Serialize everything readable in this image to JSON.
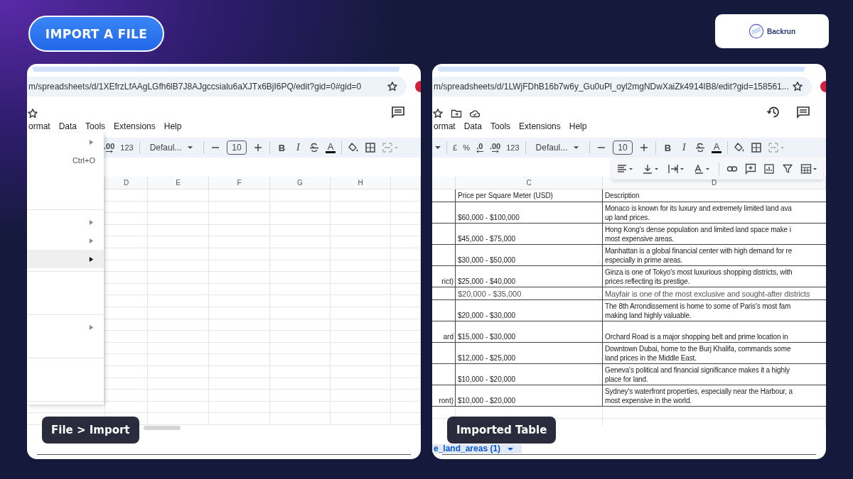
{
  "header": {
    "button": "IMPORT A FILE",
    "logo": "Backrun"
  },
  "panels": [
    {
      "kind": "menu-open",
      "url": "m/spreadsheets/d/1XEfrzLfAAgLGfh6lB7J8AJgccsialu6aXJTx6BjI6PQ/edit?gid=0#gid=0",
      "top_icons": [
        {
          "kind": "star"
        }
      ],
      "right_icons": [
        {
          "kind": "comment"
        }
      ],
      "menu": [
        "ormat",
        "Data",
        "Tools",
        "Extensions",
        "Help"
      ],
      "toolbar": [
        {
          "kind": "decimal-more",
          "label": ".00"
        },
        {
          "kind": "label",
          "label": "123"
        },
        {
          "kind": "divider"
        },
        {
          "kind": "font",
          "label": "Defaul..."
        },
        {
          "kind": "divider"
        },
        {
          "kind": "minus"
        },
        {
          "kind": "size",
          "label": "10"
        },
        {
          "kind": "plus"
        },
        {
          "kind": "divider"
        },
        {
          "kind": "bold",
          "label": "B"
        },
        {
          "kind": "italic",
          "label": "I"
        },
        {
          "kind": "strike"
        },
        {
          "kind": "text-color",
          "label": "A"
        },
        {
          "kind": "divider"
        },
        {
          "kind": "fill"
        },
        {
          "kind": "borders"
        },
        {
          "kind": "merge"
        }
      ],
      "dropdown": [
        {
          "kind": "submenu",
          "selected": false
        },
        {
          "kind": "shortcut",
          "shortcut": "Ctrl+O",
          "selected": false
        },
        {
          "kind": "blank",
          "selected": false
        },
        {
          "kind": "blank",
          "selected": false
        },
        {
          "kind": "separator"
        },
        {
          "kind": "submenu",
          "selected": false
        },
        {
          "kind": "submenu",
          "selected": false
        },
        {
          "kind": "submenu",
          "selected": true
        },
        {
          "kind": "separator"
        },
        {
          "kind": "blank",
          "selected": false
        },
        {
          "kind": "blank",
          "selected": false
        },
        {
          "kind": "separator"
        },
        {
          "kind": "submenu",
          "selected": false
        },
        {
          "kind": "blank",
          "selected": false
        },
        {
          "kind": "separator"
        },
        {
          "kind": "blank",
          "selected": false
        },
        {
          "kind": "blank",
          "selected": false
        },
        {
          "kind": "separator"
        }
      ],
      "columns": [
        "D",
        "E",
        "F",
        "G",
        "H"
      ],
      "caption": "File > Import"
    },
    {
      "kind": "table",
      "url": "m/spreadsheets/d/1LWjFDhB16b7w6y_Gu0uPl_oyl2mgNDwXaiZk4914IB8/edit?gid=158561...",
      "top_icons": [
        {
          "kind": "star"
        },
        {
          "kind": "folder"
        },
        {
          "kind": "cloud"
        }
      ],
      "right_icons": [
        {
          "kind": "history"
        },
        {
          "kind": "comment"
        }
      ],
      "menu": [
        "ormat",
        "Data",
        "Tools",
        "Extensions",
        "Help"
      ],
      "toolbar": [
        {
          "kind": "caret"
        },
        {
          "kind": "divider"
        },
        {
          "kind": "label",
          "label": "£"
        },
        {
          "kind": "label",
          "label": "%"
        },
        {
          "kind": "decimal-less",
          "label": ".0"
        },
        {
          "kind": "decimal-more",
          "label": ".00"
        },
        {
          "kind": "label",
          "label": "123"
        },
        {
          "kind": "divider"
        },
        {
          "kind": "font",
          "label": "Defaul..."
        },
        {
          "kind": "divider"
        },
        {
          "kind": "minus"
        },
        {
          "kind": "size",
          "label": "10"
        },
        {
          "kind": "plus"
        },
        {
          "kind": "divider"
        },
        {
          "kind": "bold",
          "label": "B"
        },
        {
          "kind": "italic",
          "label": "I"
        },
        {
          "kind": "strike"
        },
        {
          "kind": "text-color",
          "label": "A"
        },
        {
          "kind": "divider"
        },
        {
          "kind": "fill"
        },
        {
          "kind": "borders"
        },
        {
          "kind": "merge"
        }
      ],
      "toolbar2": [
        {
          "kind": "align"
        },
        {
          "kind": "valign"
        },
        {
          "kind": "wrap"
        },
        {
          "kind": "rotate"
        },
        {
          "kind": "divider"
        },
        {
          "kind": "link"
        },
        {
          "kind": "comment-add"
        },
        {
          "kind": "chart"
        },
        {
          "kind": "filter"
        },
        {
          "kind": "table"
        }
      ],
      "columns": [
        "C",
        "D"
      ],
      "rows": [
        {
          "kind": "header",
          "price": "Price per Square Meter (USD)",
          "desc": [
            "Description"
          ]
        },
        {
          "kind": "tall",
          "price": "$60,000 - $100,000",
          "desc": [
            "Monaco is known for its luxury and extremely limited land ava",
            "up land prices."
          ]
        },
        {
          "kind": "tall",
          "price": "$45,000 - $75,000",
          "desc": [
            "Hong Kong's dense population and limited land space make i",
            "most expensive areas."
          ]
        },
        {
          "kind": "tall",
          "price": "$30,000 - $50,000",
          "desc": [
            "Manhattan is a global financial center with high demand for re",
            "especially in prime areas."
          ]
        },
        {
          "kind": "tall",
          "b": "rict)",
          "price": "$25,000 - $40,000",
          "desc": [
            "Ginza is one of Tokyo's most luxurious shopping districts, with",
            "prices reflecting its prestige."
          ]
        },
        {
          "kind": "short",
          "price": "$20,000 - $35,000",
          "desc": [
            "Mayfair is one of the most exclusive and sought-after districts"
          ]
        },
        {
          "kind": "tall",
          "price": "$20,000 - $30,000",
          "desc": [
            "The 8th Arrondissement is home to some of Paris's most fam",
            "making land highly valuable."
          ]
        },
        {
          "kind": "tall",
          "b": "ard",
          "price": "$15,000 - $30,000",
          "desc": [
            "Orchard Road is a major shopping belt and prime location in"
          ]
        },
        {
          "kind": "tall",
          "price": "$12,000 - $25,000",
          "desc": [
            "Downtown Dubai, home to the Burj Khalifa, commands some",
            "land prices in the Middle East."
          ]
        },
        {
          "kind": "tall",
          "price": "$10,000 - $20,000",
          "desc": [
            "Geneva's political and financial significance makes it a highly",
            "place for land."
          ]
        },
        {
          "kind": "tall",
          "b": "ront)",
          "price": "$10,000 - $20,000",
          "desc": [
            "Sydney's waterfront properties, especially near the Harbour, a",
            "most expensive in the world."
          ]
        }
      ],
      "sheet_tab": "e_land_areas (1)",
      "caption": "Imported Table"
    }
  ]
}
